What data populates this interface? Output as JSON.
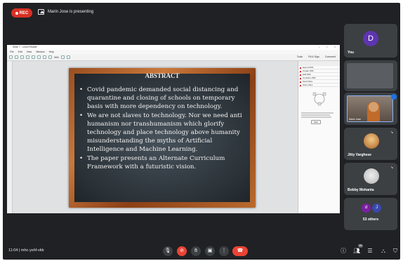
{
  "topbar": {
    "rec_label": "REC",
    "presenting_text": "Marin Jose is presenting"
  },
  "shared_window": {
    "title": "Slide 7 - Leoni Reader",
    "menu": [
      "File",
      "Edit",
      "View",
      "Window",
      "Help"
    ],
    "toolbar_zoom": "96%",
    "toolbar_right": [
      "Tools",
      "Fill & Sign",
      "Comment"
    ],
    "panel_items": [
      "Export PDF",
      "Create PDF",
      "Edit PDF",
      "Combine PDF",
      "Send Files",
      "Store Files"
    ],
    "panel_button": "Start"
  },
  "slide": {
    "title": "ABSTRACT",
    "bullets": [
      "Covid pandemic demanded social distancing and quarantine and closing of  schools on temporary basis with more dependency on technology.",
      "We are not slaves to technology. Nor we need anti humanism nor transhumanism which glorify technology and place technology above humanity misunderstanding the myths of Artificial Intelligence and Machine Learning.",
      "The paper presents an Alternate Curriculum Framework with a futuristic vision."
    ]
  },
  "participants": {
    "you": {
      "initial": "D",
      "name": "You"
    },
    "presenter_cam": {
      "name": "Marin Jose"
    },
    "jitty": {
      "name": "Jitty Varghese"
    },
    "bobby": {
      "name": "Bobby Mohanta"
    },
    "others": {
      "initials": [
        "d",
        "J"
      ],
      "label": "53 others"
    }
  },
  "bottombar": {
    "time": "11:04",
    "separator": "|",
    "meeting_code": "mhc-yshf-vkb",
    "participants_count": "55"
  },
  "colors": {
    "background": "#202124",
    "tile": "#3c4043",
    "danger": "#ea4335",
    "avatar_d": "#5e35b1",
    "avatar_small_d": "#7b1fa2",
    "avatar_small_j": "#3949ab"
  }
}
